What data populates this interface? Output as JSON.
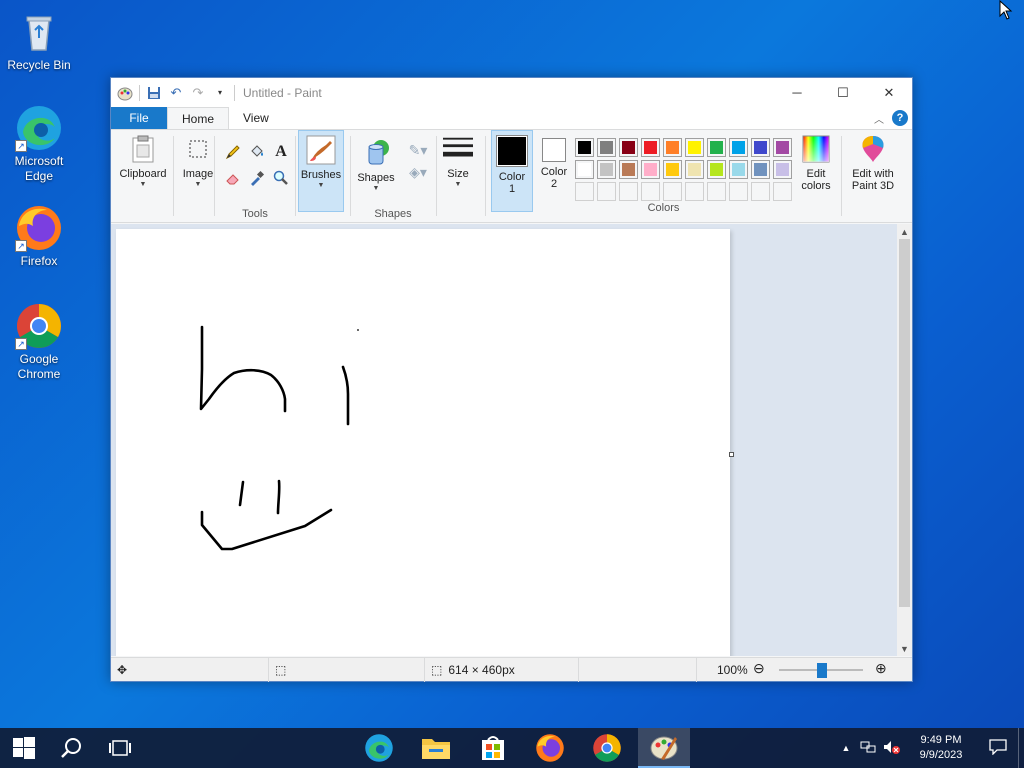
{
  "desktop": {
    "icons": [
      {
        "label": "Recycle Bin"
      },
      {
        "label": "Microsoft Edge"
      },
      {
        "label": "Firefox"
      },
      {
        "label": "Google Chrome"
      }
    ]
  },
  "window": {
    "title": "Untitled - Paint",
    "menu": {
      "file": "File",
      "home": "Home",
      "view": "View"
    },
    "ribbon": {
      "clipboard": "Clipboard",
      "image": "Image",
      "tools": "Tools",
      "brushes": "Brushes",
      "shapes_btn": "Shapes",
      "shapes_group": "Shapes",
      "size": "Size",
      "color1_line1": "Color",
      "color1_line2": "1",
      "color2_line1": "Color",
      "color2_line2": "2",
      "colors_group": "Colors",
      "edit_colors_line1": "Edit",
      "edit_colors_line2": "colors",
      "paint3d_line1": "Edit with",
      "paint3d_line2": "Paint 3D"
    },
    "palette_row1": [
      "#000000",
      "#7f7f7f",
      "#880015",
      "#ed1c24",
      "#ff7f27",
      "#fff200",
      "#22b14c",
      "#00a2e8",
      "#3f48cc",
      "#a349a4"
    ],
    "palette_row2": [
      "#ffffff",
      "#c3c3c3",
      "#b97a57",
      "#ffaec9",
      "#ffc90e",
      "#efe4b0",
      "#b5e61d",
      "#99d9ea",
      "#7092be",
      "#c8bfe7"
    ],
    "color1": "#000000",
    "color2": "#ffffff",
    "status": {
      "dimensions": "614 × 460px",
      "zoom": "100%"
    }
  },
  "taskbar": {
    "time": "9:49 PM",
    "date": "9/9/2023"
  }
}
